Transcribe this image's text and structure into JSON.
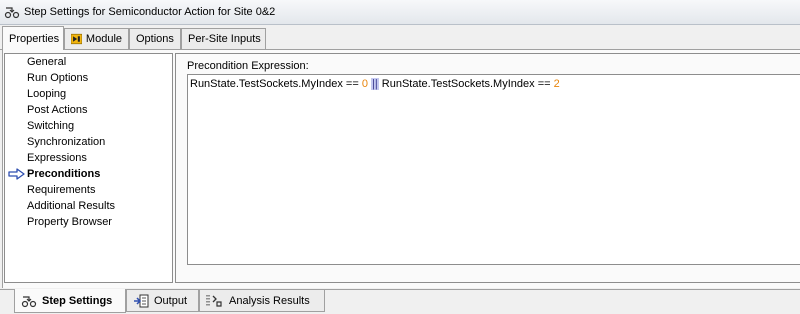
{
  "window": {
    "title": "Step Settings for Semiconductor Action for Site 0&2"
  },
  "top_tabs": [
    {
      "label": "Properties"
    },
    {
      "label": "Module"
    },
    {
      "label": "Options"
    },
    {
      "label": "Per-Site Inputs"
    }
  ],
  "left_list": {
    "items": [
      {
        "label": "General"
      },
      {
        "label": "Run Options"
      },
      {
        "label": "Looping"
      },
      {
        "label": "Post Actions"
      },
      {
        "label": "Switching"
      },
      {
        "label": "Synchronization"
      },
      {
        "label": "Expressions"
      },
      {
        "label": "Preconditions"
      },
      {
        "label": "Requirements"
      },
      {
        "label": "Additional Results"
      },
      {
        "label": "Property Browser"
      }
    ],
    "selected": "Preconditions"
  },
  "precondition": {
    "label": "Precondition Expression:",
    "part1": "RunState.TestSockets.MyIndex == ",
    "num1": "0",
    "operator": "||",
    "part2": "RunState.TestSockets.MyIndex == ",
    "num2": "2"
  },
  "bottom_tabs": [
    {
      "label": "Step Settings"
    },
    {
      "label": "Output"
    },
    {
      "label": "Analysis Results"
    }
  ],
  "colors": {
    "accent_orange": "#e8850c",
    "operator_highlight": "#c4c8f0",
    "arrow_blue": "#2f4fb0"
  }
}
